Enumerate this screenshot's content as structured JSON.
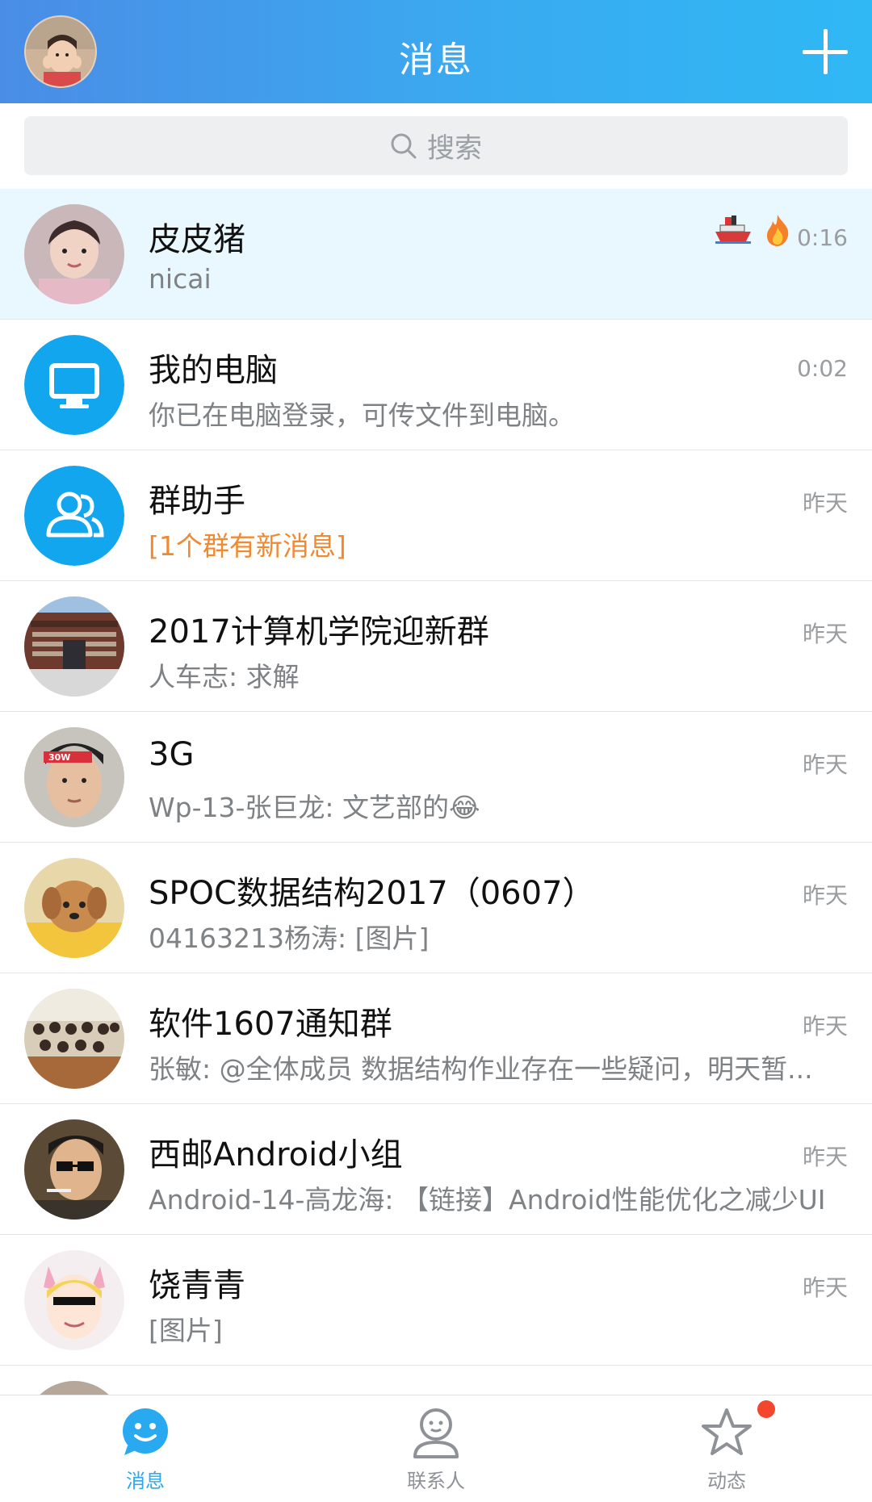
{
  "header": {
    "title": "消息",
    "add_icon": "plus-icon",
    "accent_gradient": [
      "#4a8de6",
      "#2fb8f4"
    ]
  },
  "search": {
    "label": "搜索",
    "icon": "search-icon"
  },
  "conversations": [
    {
      "name": "皮皮猪",
      "preview": "nicai",
      "time": "0:16",
      "pinned": true,
      "badges": [
        "ship-icon",
        "fire-icon"
      ]
    },
    {
      "name": "我的电脑",
      "preview": "你已在电脑登录，可传文件到电脑。",
      "time": "0:02",
      "avatar_icon": "monitor-icon"
    },
    {
      "name": "群助手",
      "preview": "[1个群有新消息]",
      "time": "昨天",
      "avatar_icon": "group-icon",
      "preview_color": "#f08a32"
    },
    {
      "name": "2017计算机学院迎新群",
      "preview": "人车志: 求解",
      "time": "昨天"
    },
    {
      "name": "3G",
      "preview": "Wp-13-张巨龙: 文艺部的😂",
      "time": "昨天"
    },
    {
      "name": "SPOC数据结构2017（0607）",
      "preview": "04163213杨涛: [图片]",
      "time": "昨天"
    },
    {
      "name": "软件1607通知群",
      "preview": "张敏: @全体成员 数据结构作业存在一些疑问，明天暂...",
      "time": "昨天"
    },
    {
      "name": "西邮Android小组",
      "preview": "Android-14-高龙海: 【链接】Android性能优化之减少UI...",
      "time": "昨天"
    },
    {
      "name": "饶青青",
      "preview": "[图片]",
      "time": "昨天"
    }
  ],
  "tabs": [
    {
      "label": "消息",
      "icon": "smile-bubble-icon",
      "active": true
    },
    {
      "label": "联系人",
      "icon": "contact-icon",
      "active": false
    },
    {
      "label": "动态",
      "icon": "star-icon",
      "active": false,
      "notification_dot": true
    }
  ]
}
